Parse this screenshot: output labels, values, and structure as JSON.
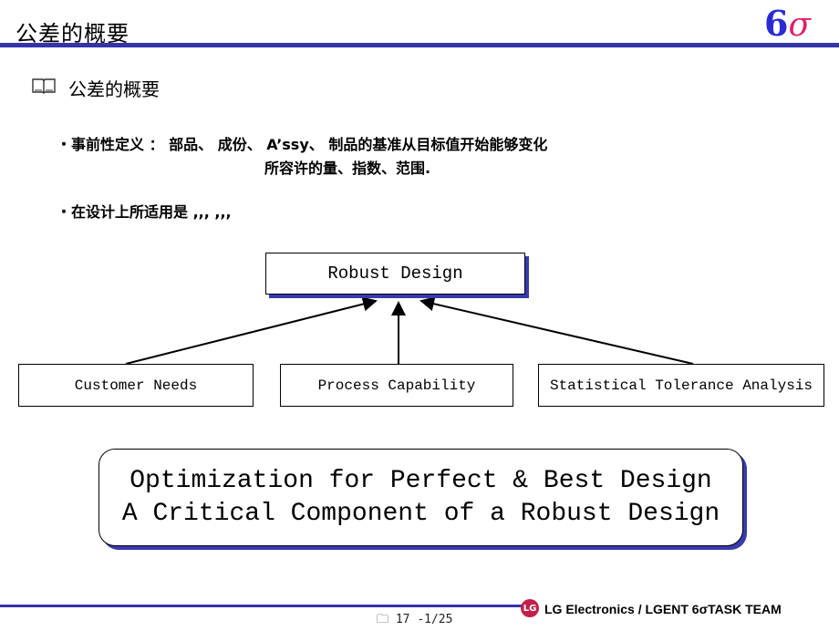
{
  "header": {
    "title": "公差的概要",
    "logo_six": "6",
    "logo_sigma": "σ"
  },
  "section": {
    "icon": "book-icon",
    "title": "公差的概要"
  },
  "bullets": [
    {
      "line1": "・事前性定义 ： 部品、 成份、 A’ssy、 制品的基准从目标值开始能够变化",
      "line2": "所容许的量、指数、范围."
    },
    {
      "line1": "・在设计上所适用是 ,,, ,,,"
    }
  ],
  "diagram": {
    "top": "Robust Design",
    "inputs": [
      "Customer Needs",
      "Process Capability",
      "Statistical Tolerance Analysis"
    ]
  },
  "callout": {
    "line1": "Optimization for Perfect & Best Design",
    "line2": "A Critical Component of a Robust Design"
  },
  "footer": {
    "page": "17 -1/25",
    "page_icon": "folder-icon",
    "company": "LG Electronics  / LGENT 6σTASK  TEAM",
    "lg_logo_text": "LG"
  },
  "colors": {
    "rule": "#3333aa",
    "six": "#2a2ad6",
    "sigma": "#e0206a",
    "lg": "#c0204a"
  }
}
